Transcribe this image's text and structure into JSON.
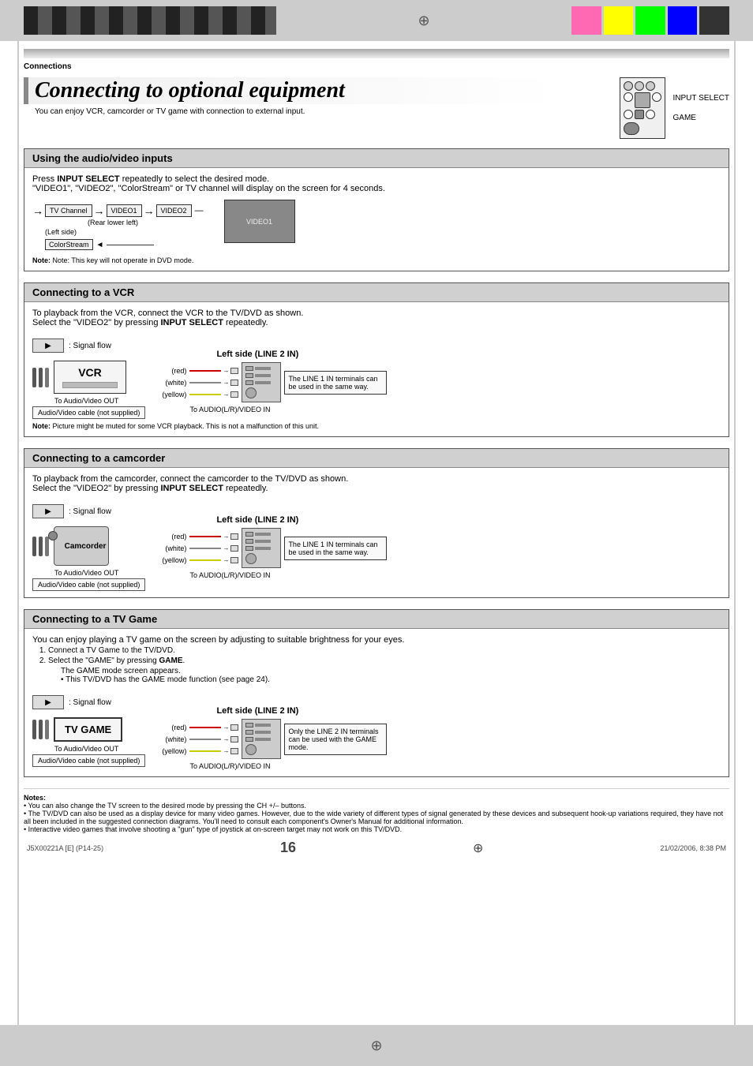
{
  "page": {
    "number": "16",
    "footer_left": "J5X00221A [E] (P14-25)",
    "footer_center": "16",
    "footer_right": "21/02/2006, 8:38 PM"
  },
  "header": {
    "breadcrumb": "Connections"
  },
  "title": {
    "main": "Connecting to optional equipment",
    "subtitle": "You can enjoy VCR, camcorder or TV game with connection to external input.",
    "diagram_label1": "INPUT SELECT",
    "diagram_label2": "GAME"
  },
  "section_audio": {
    "header": "Using the audio/video inputs",
    "body1": "Press INPUT SELECT repeatedly to select the desired mode.",
    "body2": "\"VIDEO1\", \"VIDEO2\", \"ColorStream\" or TV channel will display on the screen for 4 seconds.",
    "flow": {
      "tv_channel": "TV Channel",
      "video1": "VIDEO1",
      "rear_lower_left": "(Rear lower left)",
      "video2": "VIDEO2",
      "left_side": "(Left side)",
      "colorstream": "ColorStream"
    },
    "note": "Note: This key will not operate in DVD mode.",
    "video1_label": "VIDEO1"
  },
  "section_vcr": {
    "header": "Connecting to a VCR",
    "body1": "To playback from the VCR, connect the VCR to the TV/DVD as shown.",
    "body2": "Select the \"VIDEO2\" by pressing INPUT SELECT repeatedly.",
    "signal_flow_label": ": Signal flow",
    "vcr_label": "VCR",
    "left_side_label": "Left side (LINE 2 IN)",
    "red_label": "(red)",
    "white_label": "(white)",
    "yellow_label": "(yellow)",
    "to_audio_out": "To Audio/Video OUT",
    "cable_label": "Audio/Video cable  (not supplied)",
    "to_audio_in": "To AUDIO(L/R)/VIDEO IN",
    "side_note": "The LINE 1 IN terminals can be used in the same way."
  },
  "section_camcorder": {
    "header": "Connecting to a camcorder",
    "body1": "To playback from the camcorder, connect the camcorder to the TV/DVD as shown.",
    "body2": "Select the \"VIDEO2\" by pressing INPUT SELECT repeatedly.",
    "signal_flow_label": ": Signal flow",
    "camcorder_label": "Camcorder",
    "left_side_label": "Left side (LINE 2 IN)",
    "red_label": "(red)",
    "white_label": "(white)",
    "yellow_label": "(yellow)",
    "to_audio_out": "To Audio/Video OUT",
    "cable_label": "Audio/Video cable (not supplied)",
    "to_audio_in": "To AUDIO(L/R)/VIDEO IN",
    "side_note": "The LINE 1 IN terminals can be used in the same way."
  },
  "section_tvgame": {
    "header": "Connecting to a TV Game",
    "body_intro": "You can enjoy playing a TV game on the screen by adjusting to suitable brightness for your eyes.",
    "list": [
      "Connect a TV Game to the TV/DVD.",
      "Select the \"GAME\" by pressing GAME.",
      "The GAME mode screen appears.",
      "This TV/DVD has the GAME mode function (see page 24)."
    ],
    "signal_flow_label": ": Signal flow",
    "tv_game_label": "TV GAME",
    "left_side_label": "Left side (LINE 2 IN)",
    "red_label": "(red)",
    "white_label": "(white)",
    "yellow_label": "(yellow)",
    "to_audio_out": "To Audio/Video OUT",
    "cable_label": "Audio/Video cable (not supplied)",
    "to_audio_in": "To AUDIO(L/R)/VIDEO IN",
    "side_note": "Only the LINE 2 IN terminals can be used with the GAME mode."
  },
  "notes": {
    "title": "Notes:",
    "items": [
      "You can also change the TV screen to the desired mode by pressing the CH +/– buttons.",
      "The TV/DVD can also be used as a display device for many video games. However, due to the wide variety of different types of signal generated by these devices and subsequent hook-up variations required, they have not all been included in the suggested connection diagrams. You'll need to consult each component's Owner's Manual for additional information.",
      "Interactive video games that involve shooting a \"gun\" type of joystick at on-screen target may not work on this TV/DVD."
    ]
  }
}
